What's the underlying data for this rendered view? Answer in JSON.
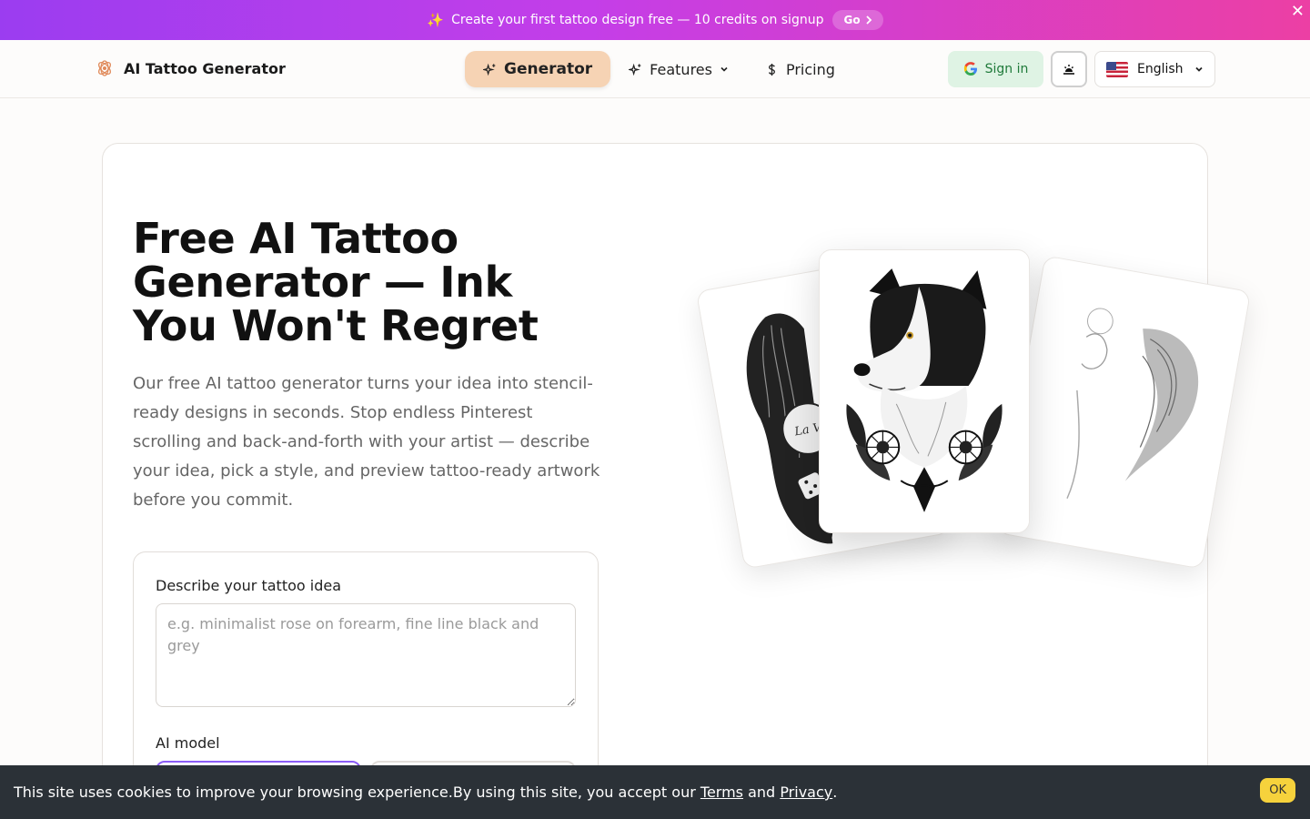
{
  "promo": {
    "spark_icon": "✨",
    "text": "Create your first tattoo design free — 10 credits on signup",
    "go_label": "Go",
    "close_label": "✕"
  },
  "nav": {
    "brand": "AI Tattoo Generator",
    "items": [
      {
        "label": "Generator",
        "icon": "sparkles-icon",
        "active": true
      },
      {
        "label": "Features",
        "icon": "sparkles-icon",
        "has_dropdown": true
      },
      {
        "label": "Pricing",
        "icon": "dollar-icon"
      }
    ],
    "signin_label": "Sign in",
    "language": "English"
  },
  "hero": {
    "title": "Free AI Tattoo Generator — Ink You Won't Regret",
    "description": "Our free AI tattoo generator turns your idea into stencil-ready designs in seconds. Stop endless Pinterest scrolling and back-and-forth with your artist — describe your idea, pick a style, and preview tattoo-ready artwork before you commit."
  },
  "form": {
    "idea_label": "Describe your tattoo idea",
    "idea_placeholder": "e.g. minimalist rose on forearm, fine line black and grey",
    "idea_value": "",
    "model_label": "AI model"
  },
  "cookie": {
    "text": "This site uses cookies to improve your browsing experience.By using this site, you accept our",
    "terms": "Terms",
    "and": "and",
    "privacy": "Privacy",
    "period": ".",
    "ok_label": "OK"
  },
  "colors": {
    "promo_gradient_start": "#9b3df0",
    "promo_gradient_end": "#ec3fa4",
    "active_nav": "#f6d3b4",
    "signin_bg": "#dff3e4",
    "model_selected_border": "#8b5cf6",
    "cookie_bg": "#2b3137",
    "ok_button": "#f6d23c"
  }
}
